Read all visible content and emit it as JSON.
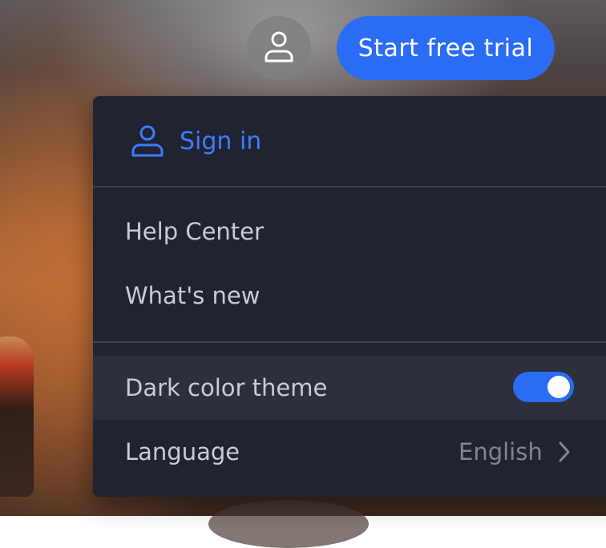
{
  "header": {
    "avatar_icon": "user-icon",
    "trial_label": "Start free trial"
  },
  "menu": {
    "signin": {
      "icon": "user-icon",
      "label": "Sign in"
    },
    "items": [
      {
        "label": "Help Center"
      },
      {
        "label": "What's new"
      }
    ],
    "theme": {
      "label": "Dark color theme",
      "enabled": true
    },
    "language": {
      "label": "Language",
      "value": "English",
      "icon": "chevron-right-icon"
    }
  },
  "colors": {
    "accent": "#2b6cf5",
    "menu_bg": "#1f2430",
    "signin_text": "#3d7bff"
  }
}
